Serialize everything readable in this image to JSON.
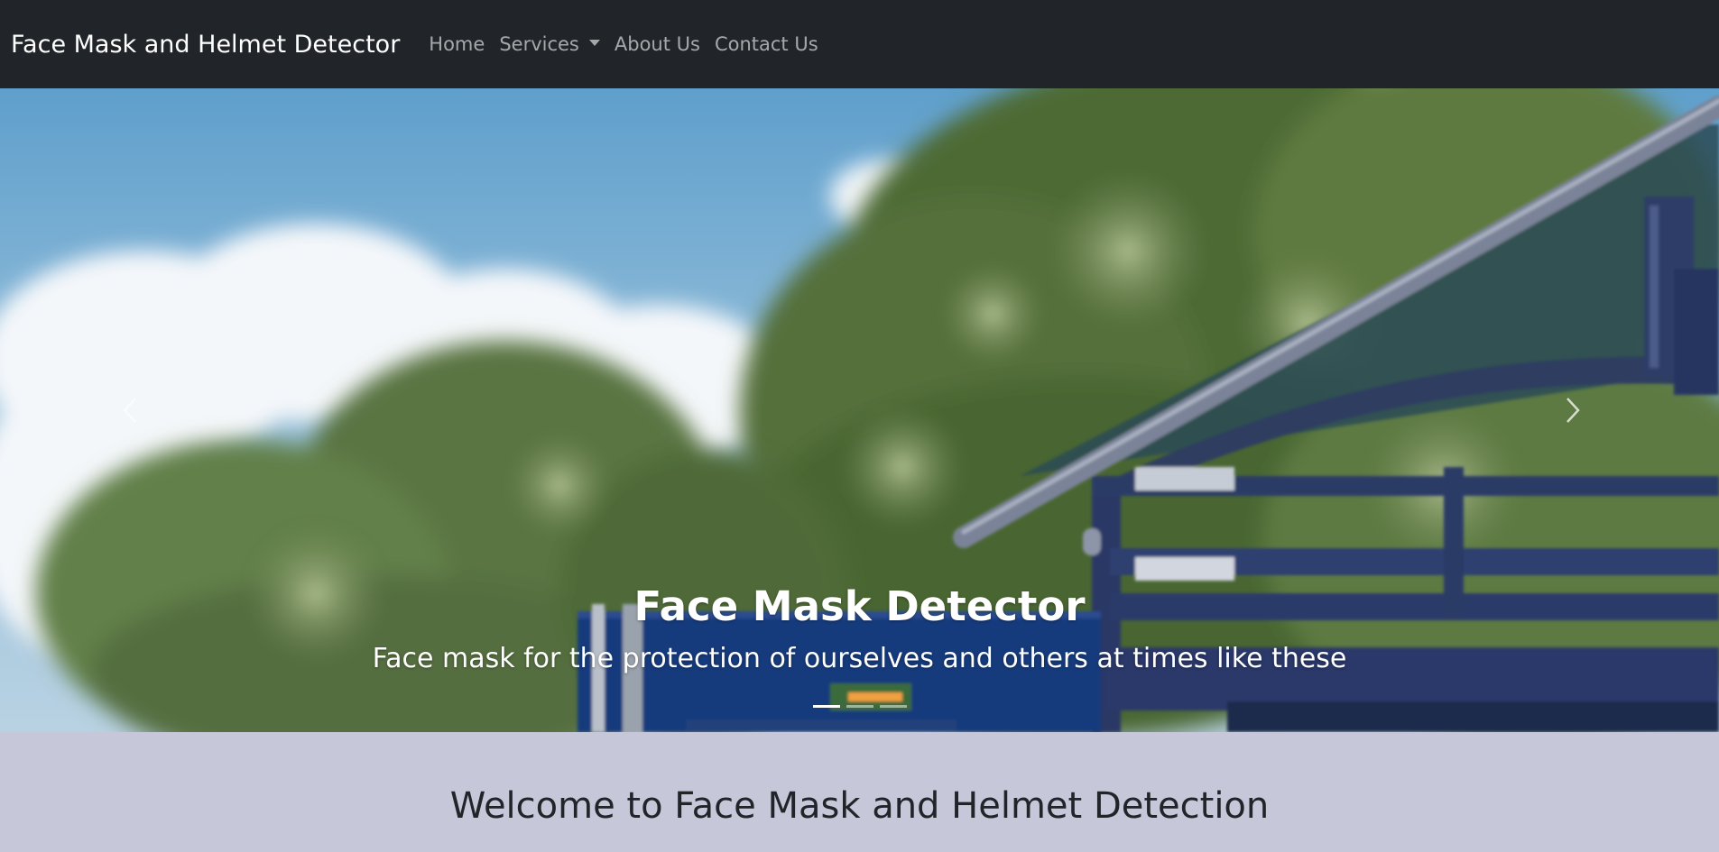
{
  "navbar": {
    "brand": "Face Mask and Helmet Detector",
    "links": [
      {
        "label": "Home"
      },
      {
        "label": "Services",
        "dropdown": true
      },
      {
        "label": "About Us"
      },
      {
        "label": "Contact Us"
      }
    ]
  },
  "carousel": {
    "active_index": 0,
    "slide_count": 3,
    "caption": {
      "title": "Face Mask Detector",
      "text": "Face mask for the protection of ourselves and others at times like these"
    },
    "icons": {
      "prev": "chevron-left-icon",
      "next": "chevron-right-icon"
    }
  },
  "welcome": {
    "title": "Welcome to Face Mask and Helmet Detection"
  },
  "colors": {
    "navbar_bg": "#212529",
    "nav_link": "rgba(255,255,255,0.6)",
    "welcome_bg": "#c6c8d9",
    "heading_text": "#212529"
  }
}
